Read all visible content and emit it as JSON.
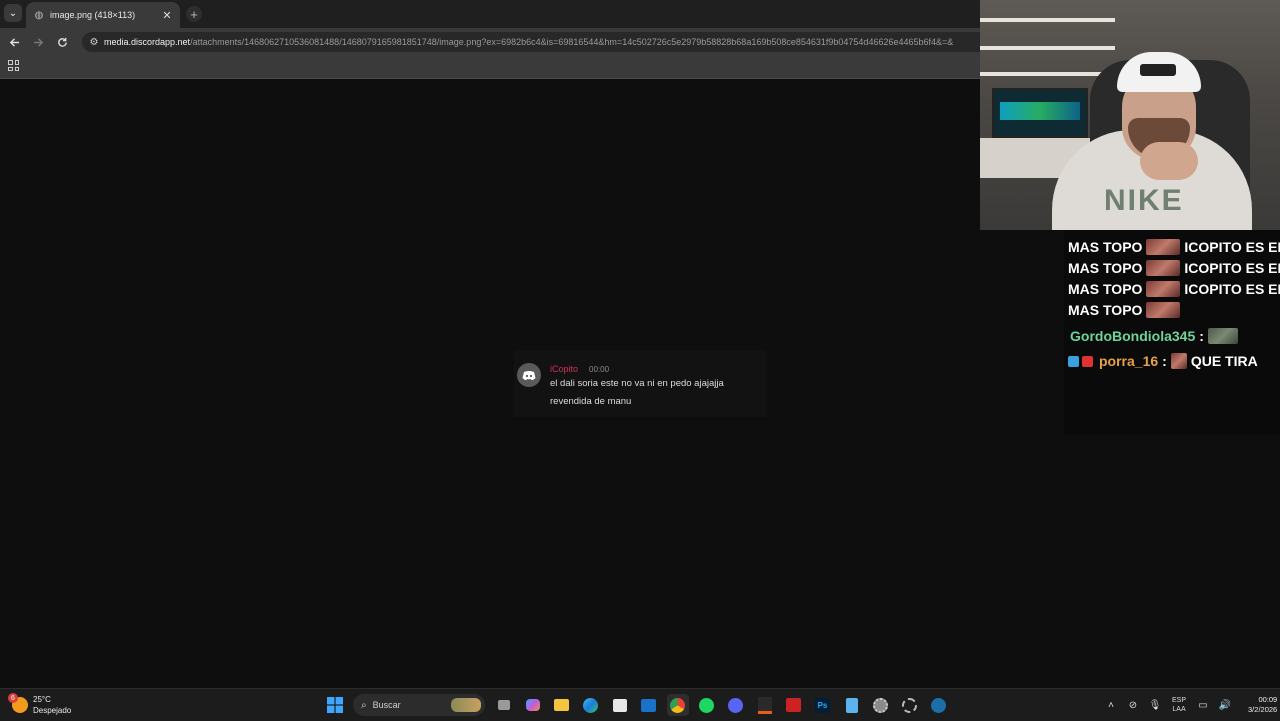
{
  "browser": {
    "tab_title": "image.png (418×113)",
    "url_domain": "media.discordapp.net",
    "url_path": "/attachments/1468062710536081488/1468079165981851748/image.png?ex=6982b6c4&is=69816544&hm=14c502726c5e2979b58828b68a169b508ce854631f9b04754d46626e4465b6f4&=&"
  },
  "discord_message": {
    "username": "iCopito",
    "time": "00:00",
    "line1": "el dali soria este no va ni en pedo ajajajja",
    "line2": "revendida de manu",
    "username_color": "#d32f5a"
  },
  "webcam": {
    "shirt_text": "NIKE"
  },
  "chat": {
    "lines": [
      {
        "pre": "MAS TOPO",
        "post": "ICOPITO ES EL"
      },
      {
        "pre": "MAS TOPO",
        "post": "ICOPITO ES EL"
      },
      {
        "pre": "MAS TOPO",
        "post": "ICOPITO ES EL"
      },
      {
        "pre": "MAS TOPO",
        "post": ""
      }
    ],
    "msg1": {
      "user": "GordoBondiola345",
      "sep": ":",
      "text": ""
    },
    "msg2": {
      "user": "porra_16",
      "sep": ":",
      "text": "QUE TIRA"
    },
    "colors": {
      "user1": "#6fd49a",
      "user2": "#e8a04a"
    }
  },
  "taskbar": {
    "weather_temp": "25°C",
    "weather_desc": "Despejado",
    "weather_badge": "6",
    "search_label": "Buscar",
    "lang_top": "ESP",
    "lang_bottom": "LAA",
    "time": "00:09",
    "date": "3/2/2026",
    "icons": [
      "windows-start-icon",
      "task-view-icon",
      "copilot-icon",
      "file-explorer-icon",
      "edge-icon",
      "store-icon",
      "outlook-icon",
      "chrome-icon",
      "spotify-icon",
      "discord-icon",
      "app-icon",
      "app-icon-2",
      "photoshop-icon",
      "notepad-icon",
      "settings-icon",
      "app-icon-3",
      "steam-icon"
    ]
  }
}
